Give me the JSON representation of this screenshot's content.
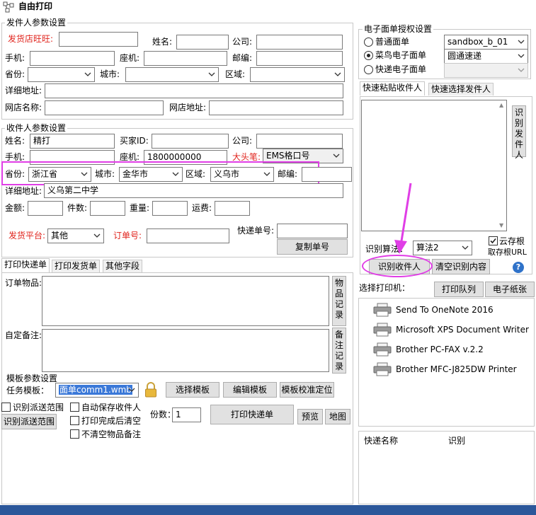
{
  "window": {
    "title": "自由打印"
  },
  "sender": {
    "group_title": "发件人参数设置",
    "shop_ww_label": "发货店旺旺:",
    "name_label": "姓名:",
    "company_label": "公司:",
    "mobile_label": "手机:",
    "phone_label": "座机:",
    "zip_label": "邮编:",
    "province_label": "省份:",
    "city_label": "城市:",
    "district_label": "区域:",
    "address_label": "详细地址:",
    "shop_name_label": "网店名称:",
    "shop_url_label": "网店地址:"
  },
  "auth": {
    "group_title": "电子面单授权设置",
    "options": [
      "普通面单",
      "菜鸟电子面单",
      "快递电子面单"
    ],
    "selected_index": 1,
    "account_value": "sandbox_b_01",
    "express_value": "圆通速递"
  },
  "paste_tabs": [
    "快速粘贴收件人",
    "快速选择发件人"
  ],
  "recognize": {
    "side_button": "识别发件人",
    "algorithm_label": "识别算法：",
    "algorithm_value": "算法2",
    "cloud_label": "云存根",
    "cloud_sub": "取存根URL",
    "recognize_button": "识别收件人",
    "clear_button": "清空识别内容",
    "help_icon": "?"
  },
  "receiver": {
    "group_title": "收件人参数设置",
    "name_label": "姓名:",
    "name_value": "精打",
    "buyer_label": "买家ID:",
    "company_label": "公司:",
    "mobile_label": "手机:",
    "phone_label": "座机:",
    "phone_value": "1800000000",
    "bigpen_label": "大头笔:",
    "bigpen_value": "EMS格口号",
    "province_label": "省份:",
    "province_value": "浙江省",
    "city_label": "城市:",
    "city_value": "金华市",
    "district_label": "区域:",
    "district_value": "义乌市",
    "zip_label": "邮编:",
    "address_label": "详细地址:",
    "address_value": "义乌第二中学",
    "amount_label": "金额:",
    "count_label": "件数:",
    "weight_label": "重量:",
    "freight_label": "运费:",
    "platform_label": "发货平台:",
    "platform_value": "其他",
    "order_label": "订单号:",
    "tracking_label": "快递单号:",
    "copy_button": "复制单号"
  },
  "print_tabs": [
    "打印快递单",
    "打印发货单",
    "其他字段"
  ],
  "print": {
    "order_items_label": "订单物品:",
    "items_record_button": "物品记录",
    "custom_note_label": "自定备注:",
    "note_record_button": "备注记录",
    "template_group": "模板参数设置",
    "task_template_label": "任务模板：",
    "task_template_value": "面单comm1.wmb",
    "select_template_button": "选择模板",
    "edit_template_button": "编辑模板",
    "calibrate_button": "模板校准定位",
    "dispatch_range_check": "识别派送范围",
    "dispatch_range_button": "识别派送范围",
    "autosave_check": "自动保存收件人",
    "clear_after_check": "打印完成后清空",
    "keep_items_check": "不清空物品备注",
    "copies_label": "份数：",
    "copies_value": "1",
    "print_button": "打印快递单",
    "preview_button": "预览",
    "map_button": "地图"
  },
  "printers": {
    "label": "选择打印机：",
    "queue_button": "打印队列",
    "paper_button": "电子纸张",
    "items": [
      "Send To OneNote 2016",
      "Microsoft XPS Document Writer",
      "Brother PC-FAX v.2.2",
      "Brother MFC-J825DW Printer"
    ]
  },
  "express_table": {
    "columns": [
      "快递名称",
      "识别"
    ]
  },
  "colors": {
    "highlight": "#e03ee6",
    "accent": "#2b579a",
    "red_label": "#e0231c",
    "selection": "#3a78d8"
  }
}
